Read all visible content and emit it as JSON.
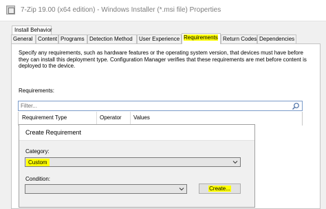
{
  "window": {
    "title": "7-Zip 19.00 (x64 edition) - Windows Installer (*.msi file) Properties"
  },
  "outer_tab": {
    "label": "Install Behavior"
  },
  "tabs": [
    {
      "label": "General"
    },
    {
      "label": "Content"
    },
    {
      "label": "Programs"
    },
    {
      "label": "Detection Method"
    },
    {
      "label": "User Experience"
    },
    {
      "label": "Requirements"
    },
    {
      "label": "Return Codes"
    },
    {
      "label": "Dependencies"
    }
  ],
  "active_tab": "Requirements",
  "description": "Specify any requirements, such as hardware features or the operating system version, that devices must have before\nthey can install this deployment type. Configuration Manager verifies that these requirements are met before content is\ndeployed to the device.",
  "requirements": {
    "label": "Requirements:",
    "filter_placeholder": "Filter...",
    "columns": [
      "Requirement Type",
      "Operator",
      "Values"
    ]
  },
  "dialog": {
    "title": "Create Requirement",
    "category_label": "Category:",
    "category_value": "Custom",
    "condition_label": "Condition:",
    "condition_value": "",
    "create_button": "Create..."
  },
  "colors": {
    "highlight": "#ffff00",
    "filter_border": "#7a9bc9"
  }
}
